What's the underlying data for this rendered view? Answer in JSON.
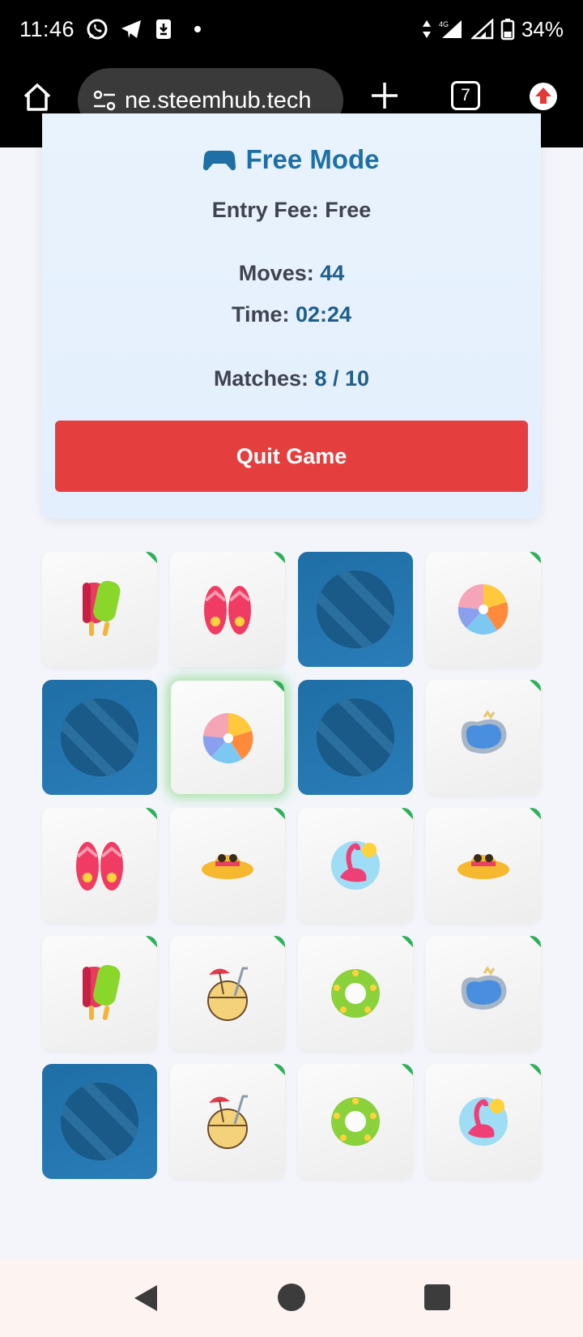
{
  "status_bar": {
    "time": "11:46",
    "network": "4G",
    "battery": "34%"
  },
  "browser": {
    "url": "ne.steemhub.tech",
    "tab_count": "7"
  },
  "game": {
    "mode": "Free Mode",
    "entry_fee_label": "Entry Fee: ",
    "entry_fee_value": "Free",
    "moves_label": "Moves: ",
    "moves_value": "44",
    "time_label": "Time: ",
    "time_value": "02:24",
    "matches_label": "Matches: ",
    "matches_value": "8 / 10",
    "quit_label": "Quit Game"
  },
  "board": {
    "tiles": [
      {
        "state": "matched",
        "icon": "popsicle-icon"
      },
      {
        "state": "matched",
        "icon": "flip-flops-icon"
      },
      {
        "state": "hidden",
        "icon": "card-back-icon"
      },
      {
        "state": "matched",
        "icon": "beach-ball-icon"
      },
      {
        "state": "hidden",
        "icon": "card-back-icon"
      },
      {
        "state": "selected",
        "icon": "beach-ball-icon"
      },
      {
        "state": "hidden",
        "icon": "card-back-icon"
      },
      {
        "state": "matched",
        "icon": "pool-icon"
      },
      {
        "state": "matched",
        "icon": "flip-flops-icon"
      },
      {
        "state": "matched",
        "icon": "sun-hat-icon"
      },
      {
        "state": "matched",
        "icon": "flamingo-float-icon"
      },
      {
        "state": "matched",
        "icon": "sun-hat-icon"
      },
      {
        "state": "matched",
        "icon": "popsicle-icon"
      },
      {
        "state": "matched",
        "icon": "coconut-drink-icon"
      },
      {
        "state": "matched",
        "icon": "swim-ring-icon"
      },
      {
        "state": "matched",
        "icon": "pool-icon"
      },
      {
        "state": "hidden",
        "icon": "card-back-icon"
      },
      {
        "state": "matched",
        "icon": "coconut-drink-icon"
      },
      {
        "state": "matched",
        "icon": "swim-ring-icon"
      },
      {
        "state": "matched",
        "icon": "flamingo-float-icon"
      }
    ]
  },
  "colors": {
    "accent_blue": "#1d6fa5",
    "quit_red": "#e53e3e",
    "card_back": "#1f6ea6",
    "match_green": "#2eb15a"
  }
}
